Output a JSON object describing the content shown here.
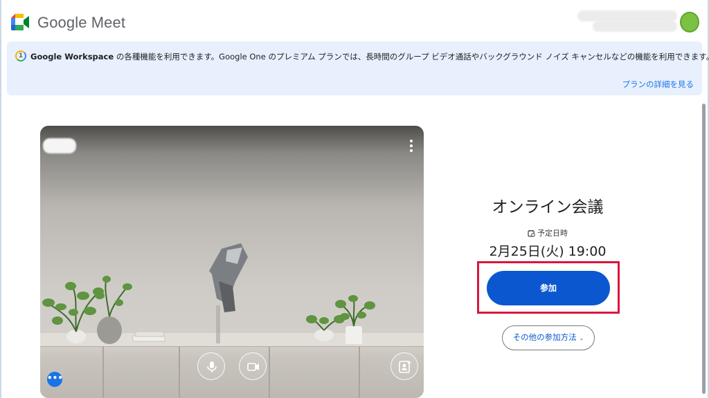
{
  "header": {
    "brand": "Google Meet"
  },
  "banner": {
    "workspace_bold": "Google Workspace",
    "text": " の各種機能を利用できます。Google One のプレミアム プランでは、長時間のグループ ビデオ通話やバックグラウンド ノイズ キャンセルなどの機能を利用できます。",
    "link": "プランの詳細を見る"
  },
  "meeting": {
    "title": "オンライン会議",
    "schedule_label": "予定日時",
    "schedule_time": "2月25日(火) 19:00",
    "join_label": "参加",
    "other_label": "その他の参加方法"
  },
  "preview": {
    "more_icon": "more-vert-icon",
    "controls": [
      "mic-icon",
      "camera-icon",
      "person-frame-icon"
    ],
    "effects_icon": "more-horiz-icon"
  },
  "colors": {
    "accent": "#0b57d0",
    "highlight": "#d9163e",
    "banner_bg": "#e8f0fe"
  }
}
